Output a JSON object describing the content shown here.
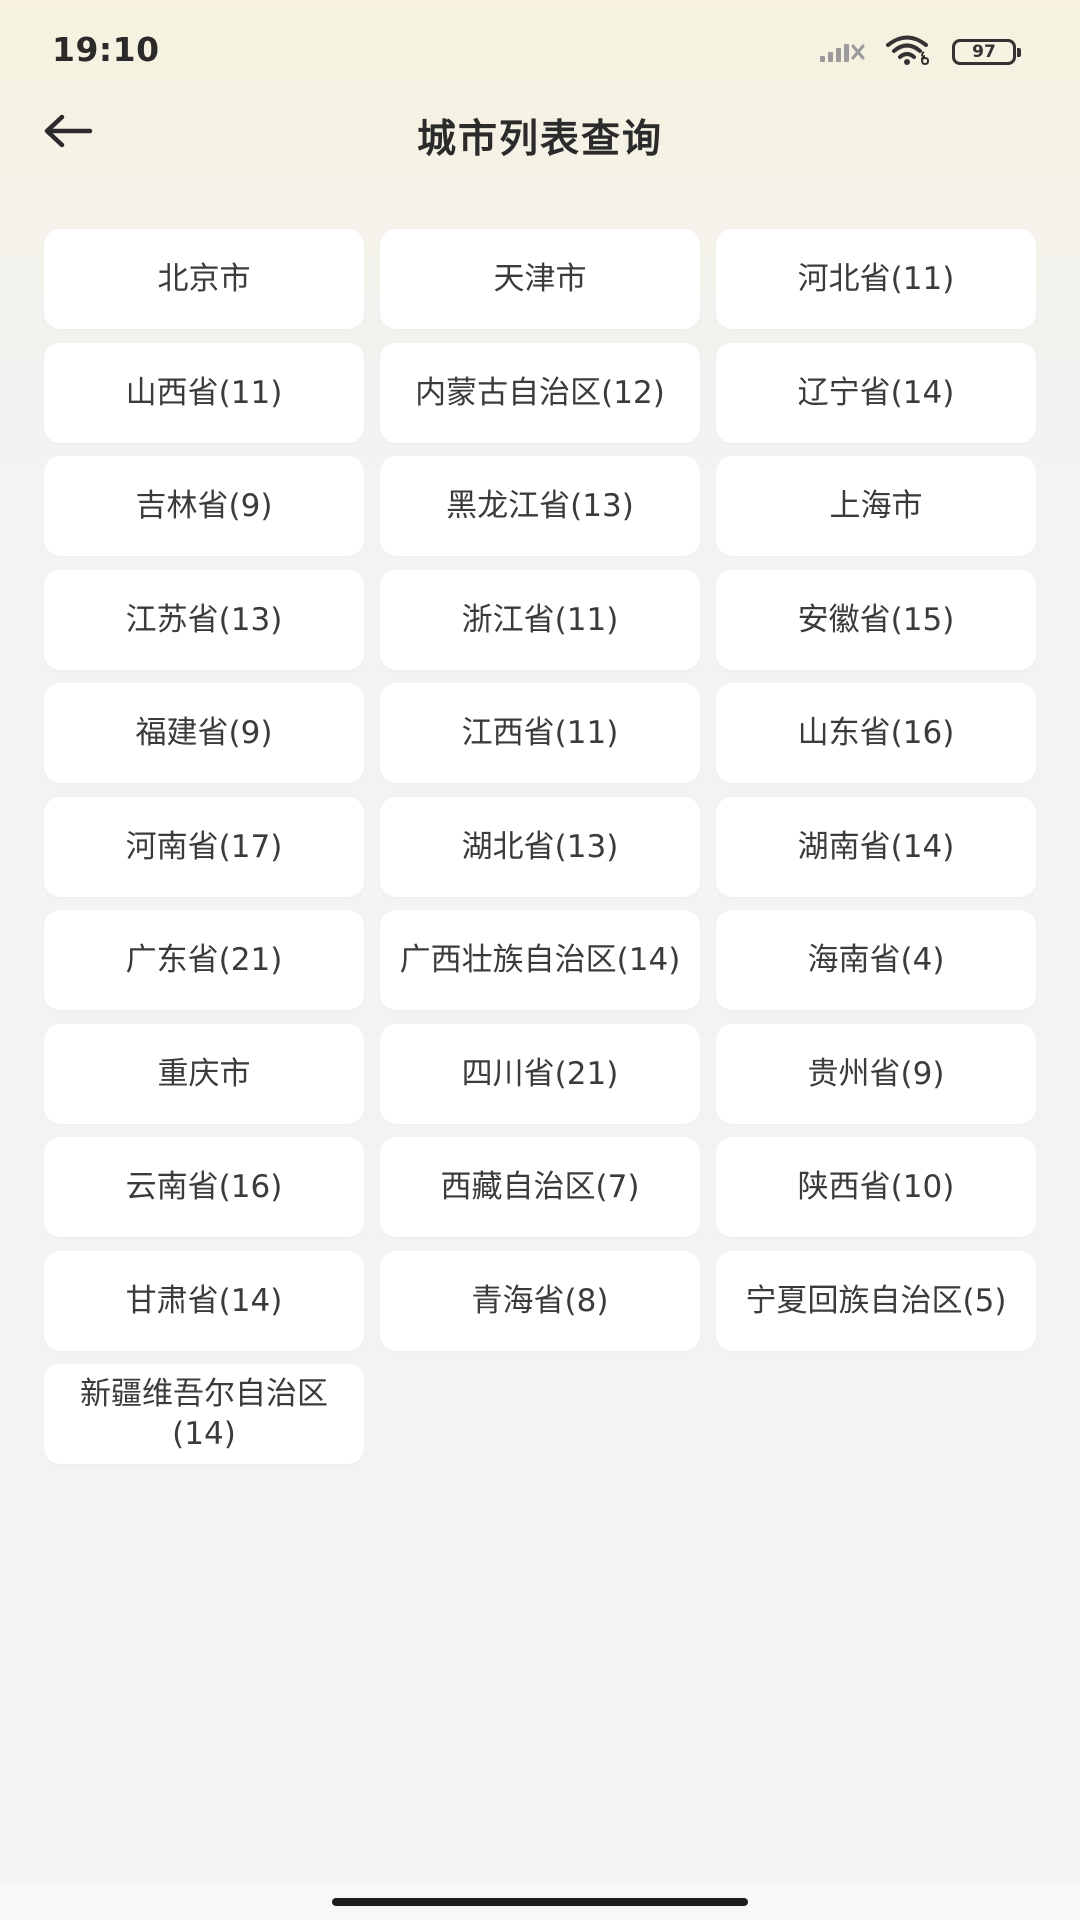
{
  "status_bar": {
    "time": "19:10",
    "battery": "97",
    "icons": [
      "signal-icon",
      "wifi-icon",
      "battery-icon"
    ]
  },
  "header": {
    "title": "城市列表查询",
    "back_icon": "arrow-left-icon"
  },
  "regions": [
    {
      "label": "北京市"
    },
    {
      "label": "天津市"
    },
    {
      "label": "河北省(11)"
    },
    {
      "label": "山西省(11)"
    },
    {
      "label": "内蒙古自治区(12)"
    },
    {
      "label": "辽宁省(14)"
    },
    {
      "label": "吉林省(9)"
    },
    {
      "label": "黑龙江省(13)"
    },
    {
      "label": "上海市"
    },
    {
      "label": "江苏省(13)"
    },
    {
      "label": "浙江省(11)"
    },
    {
      "label": "安徽省(15)"
    },
    {
      "label": "福建省(9)"
    },
    {
      "label": "江西省(11)"
    },
    {
      "label": "山东省(16)"
    },
    {
      "label": "河南省(17)"
    },
    {
      "label": "湖北省(13)"
    },
    {
      "label": "湖南省(14)"
    },
    {
      "label": "广东省(21)"
    },
    {
      "label": "广西壮族自治区(14)"
    },
    {
      "label": "海南省(4)"
    },
    {
      "label": "重庆市"
    },
    {
      "label": "四川省(21)"
    },
    {
      "label": "贵州省(9)"
    },
    {
      "label": "云南省(16)"
    },
    {
      "label": "西藏自治区(7)"
    },
    {
      "label": "陕西省(10)"
    },
    {
      "label": "甘肃省(14)"
    },
    {
      "label": "青海省(8)"
    },
    {
      "label": "宁夏回族自治区(5)"
    },
    {
      "label": "新疆维吾尔自治区(14)"
    }
  ],
  "colors": {
    "accent_background": "#f6f2df",
    "card": "#ffffff",
    "text": "#3b3b3b"
  }
}
